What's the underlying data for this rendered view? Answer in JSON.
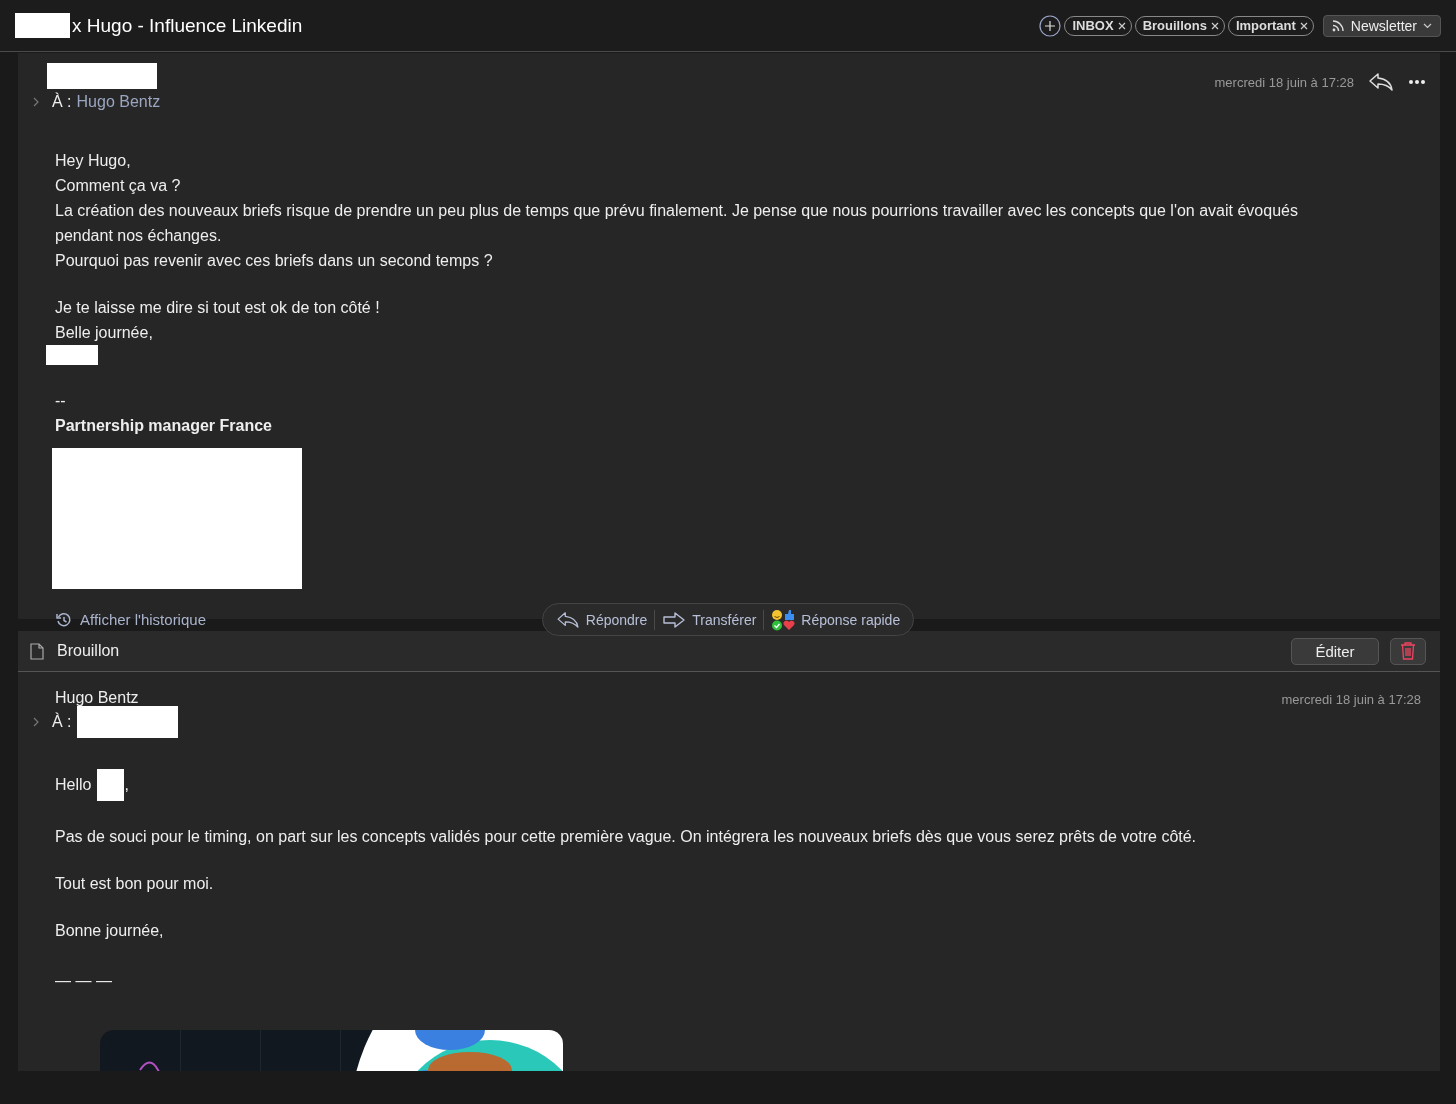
{
  "window": {
    "title": "x Hugo - Influence Linkedin"
  },
  "labels": [
    {
      "text": "INBOX",
      "kind": "removable"
    },
    {
      "text": "Brouillons",
      "kind": "removable"
    },
    {
      "text": "Important",
      "kind": "removable"
    },
    {
      "text": "Newsletter",
      "kind": "feed"
    }
  ],
  "message": {
    "date": "mercredi 18 juin à 17:28",
    "to_label": "À :",
    "recipient": "Hugo Bentz",
    "body": [
      {
        "kind": "line",
        "text": "Hey Hugo,"
      },
      {
        "kind": "line",
        "text": "Comment ça va ?"
      },
      {
        "kind": "line",
        "text": "La création des nouveaux briefs risque de prendre un peu plus de temps que prévu finalement. Je pense que nous pourrions travailler avec les concepts que l'on avait évoqués pendant nos échanges."
      },
      {
        "kind": "line",
        "text": "Pourquoi pas revenir avec ces briefs dans un second temps ?"
      },
      {
        "kind": "gap"
      },
      {
        "kind": "line",
        "text": "Je te laisse me dire si tout est ok de ton côté !"
      },
      {
        "kind": "line",
        "text": "Belle journée,"
      },
      {
        "kind": "redacted-name"
      },
      {
        "kind": "gap"
      },
      {
        "kind": "line",
        "text": "--"
      },
      {
        "kind": "title",
        "text": "Partnership manager France"
      },
      {
        "kind": "redacted-logo"
      }
    ],
    "history_link": "Afficher l'historique"
  },
  "actions": [
    {
      "label": "Répondre",
      "kind": "reply"
    },
    {
      "label": "Transférer",
      "kind": "forward"
    },
    {
      "label": "Réponse rapide",
      "kind": "quick"
    }
  ],
  "draft": {
    "title": "Brouillon",
    "edit_button": "Éditer",
    "sender": "Hugo Bentz",
    "to_label": "À :",
    "date": "mercredi 18 juin à 17:28",
    "greeting": "Hello",
    "greeting_end": ",",
    "paragraphs": [
      "Pas de souci pour le timing, on part sur les concepts validés pour cette première vague. On intégrera les nouveaux briefs dès que vous serez prêts de votre côté.",
      "Tout est bon pour moi.",
      "Bonne journée,"
    ],
    "separator": "— — —",
    "banner": {
      "kind": "picture"
    }
  }
}
